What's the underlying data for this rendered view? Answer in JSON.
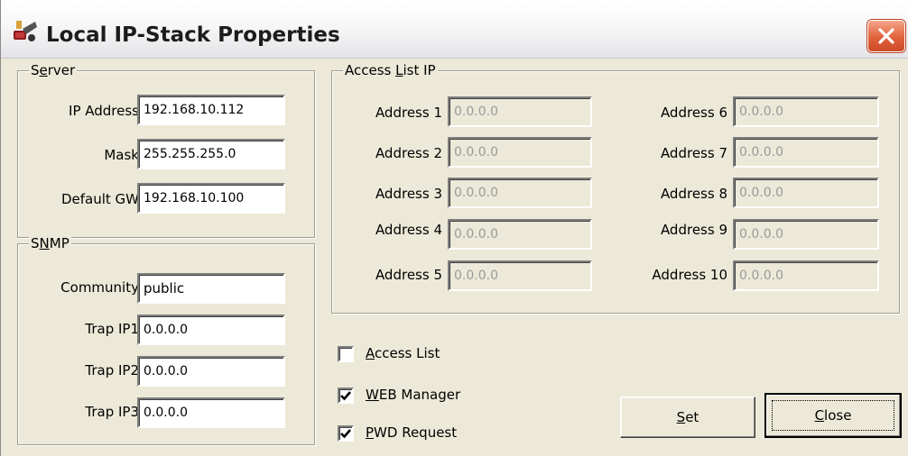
{
  "window": {
    "title": "Local IP-Stack Properties",
    "close_glyph": "✕",
    "app_icon": "network-stack-icon",
    "accent_close": "#e0623d"
  },
  "server": {
    "legend_pre": "S",
    "legend_hot": "e",
    "legend_post": "rver",
    "ip_label": "IP Address",
    "ip_value": "192.168.10.112",
    "mask_label": "Mask",
    "mask_value": "255.255.255.0",
    "gw_label": "Default GW",
    "gw_value": "192.168.10.100"
  },
  "snmp": {
    "legend_pre": "S",
    "legend_hot": "N",
    "legend_post": "MP",
    "community_label": "Community",
    "community_value": "public",
    "trap1_label": "Trap IP1",
    "trap1_value": "0.0.0.0",
    "trap2_label": "Trap IP2",
    "trap2_value": "0.0.0.0",
    "trap3_label": "Trap IP3",
    "trap3_value": "0.0.0.0"
  },
  "access_list_ip": {
    "legend_pre": "Access ",
    "legend_hot": "L",
    "legend_post": "ist IP",
    "addresses": [
      {
        "label": "Address 1",
        "value": "0.0.0.0"
      },
      {
        "label": "Address 2",
        "value": "0.0.0.0"
      },
      {
        "label": "Address 3",
        "value": "0.0.0.0"
      },
      {
        "label": "Address 4",
        "value": "0.0.0.0"
      },
      {
        "label": "Address 5",
        "value": "0.0.0.0"
      },
      {
        "label": "Address 6",
        "value": "0.0.0.0"
      },
      {
        "label": "Address 7",
        "value": "0.0.0.0"
      },
      {
        "label": "Address 8",
        "value": "0.0.0.0"
      },
      {
        "label": "Address 9",
        "value": "0.0.0.0"
      },
      {
        "label": "Address 10",
        "value": "0.0.0.0"
      }
    ]
  },
  "options": {
    "access_list": {
      "hot": "A",
      "rest": "ccess List",
      "checked": false
    },
    "web_manager": {
      "hot": "W",
      "rest": "EB Manager",
      "checked": true
    },
    "pwd_request": {
      "hot": "P",
      "rest": "WD Request",
      "checked": true
    }
  },
  "buttons": {
    "set": {
      "hot": "S",
      "rest": "et"
    },
    "close": {
      "hot": "C",
      "rest": "lose"
    }
  }
}
